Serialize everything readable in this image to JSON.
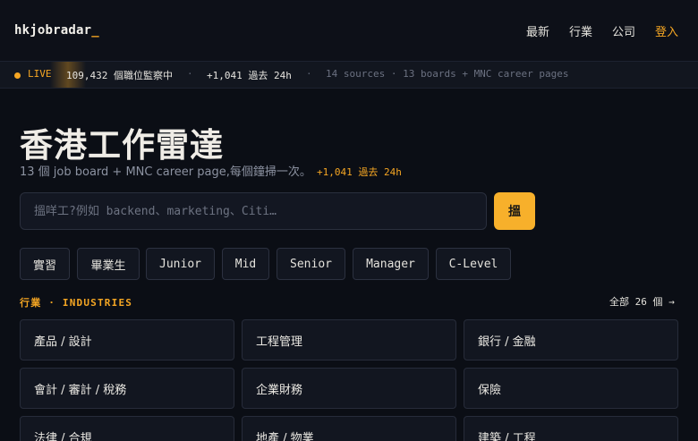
{
  "header": {
    "logo_text": "hkjobradar",
    "logo_cursor": "_",
    "nav": [
      "最新",
      "行業",
      "公司"
    ],
    "login": "登入"
  },
  "ticker": {
    "live": "LIVE",
    "count": "109,432 個職位監察中",
    "sep": "·",
    "delta": "+1,041 過去 24h",
    "sources": "14 sources · 13 boards + MNC career pages"
  },
  "hero": {
    "title": "香港工作雷達",
    "subtitle": "13 個 job board + MNC career page,每個鐘掃一次。",
    "subtitle_accent": "+1,041 過去 24h"
  },
  "search": {
    "placeholder": "搵咩工?例如 backend、marketing、Citi…",
    "button": "搵"
  },
  "levels": [
    "實習",
    "畢業生",
    "Junior",
    "Mid",
    "Senior",
    "Manager",
    "C-Level"
  ],
  "industries": {
    "title": "行業 · INDUSTRIES",
    "all": "全部 26 個 →",
    "items": [
      "產品 / 設計",
      "工程管理",
      "銀行 / 金融",
      "會計 / 審計 / 稅務",
      "企業財務",
      "保險",
      "法律 / 合規",
      "地產 / 物業",
      "建築 / 工程"
    ]
  },
  "colors": {
    "accent": "#f5a623",
    "background": "#0b0e15",
    "card": "#121620"
  }
}
